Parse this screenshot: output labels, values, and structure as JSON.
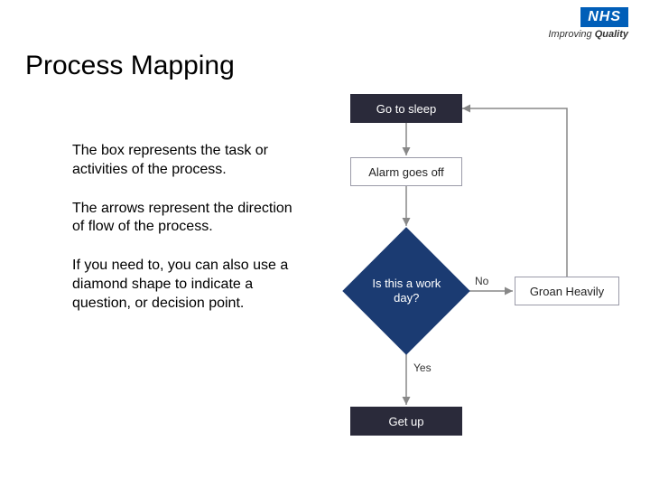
{
  "logo": {
    "brand": "NHS",
    "tagline_prefix": "Improving ",
    "tagline_bold": "Quality"
  },
  "title": "Process Mapping",
  "paragraphs": [
    "The box represents the task or activities of the process.",
    "The arrows represent the direction of flow of the process.",
    "If you need to, you can also use a diamond shape to indicate a question, or decision point."
  ],
  "flow": {
    "step1": "Go to sleep",
    "step2": "Alarm goes off",
    "decision": "Is this a work day?",
    "no_label": "No",
    "yes_label": "Yes",
    "no_result": "Groan Heavily",
    "yes_result": "Get up"
  }
}
